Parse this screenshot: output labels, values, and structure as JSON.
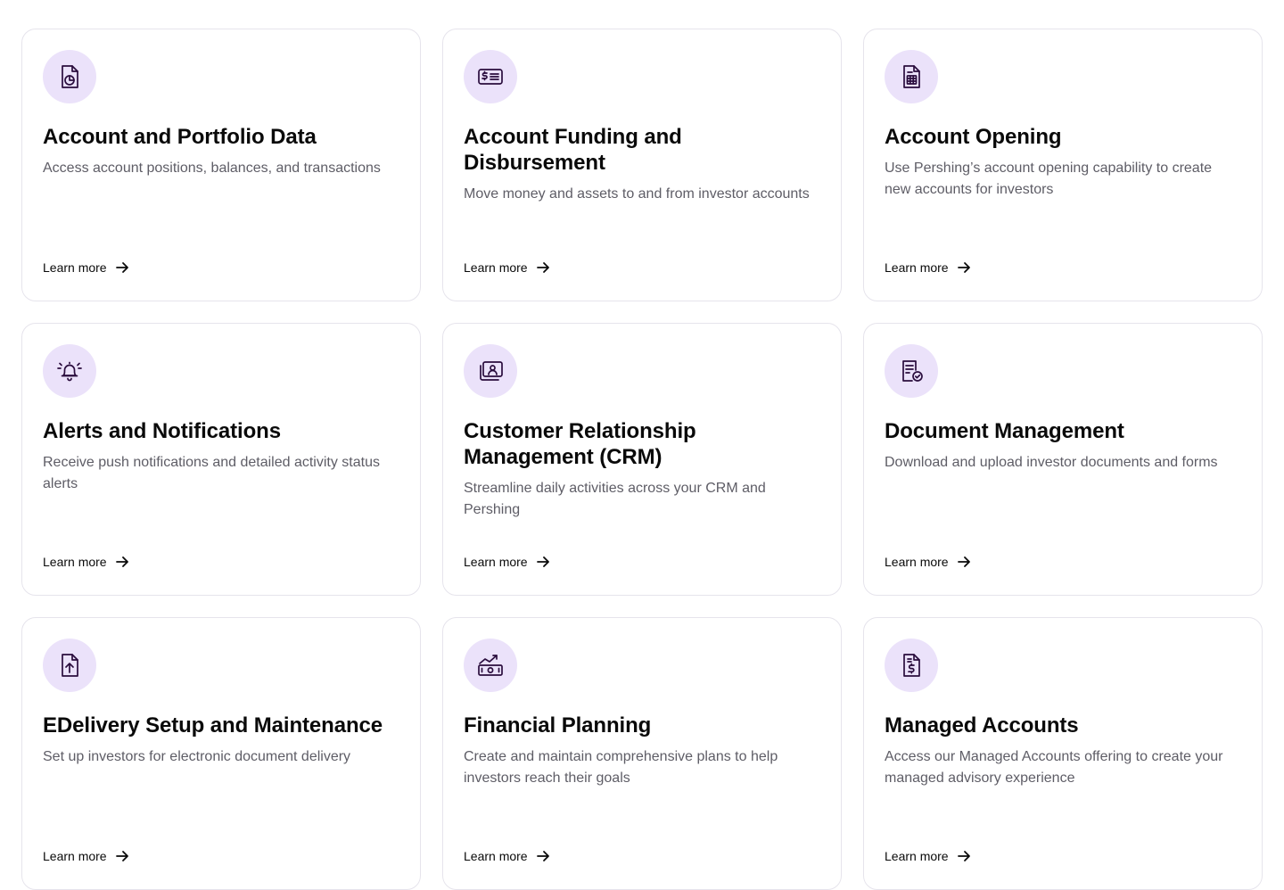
{
  "colors": {
    "icon_bg": "#ebe2fa",
    "icon_stroke": "#2a0d3d",
    "card_border": "#e6e4ec",
    "description": "#5e5d66"
  },
  "cards": [
    {
      "icon": "document-chart-icon",
      "title": "Account and Portfolio Data",
      "description": "Access account positions, balances, and transactions",
      "link": "Learn more"
    },
    {
      "icon": "dollar-card-icon",
      "title": "Account Funding and Disbursement",
      "description": "Move money and assets to and from investor accounts",
      "link": "Learn more"
    },
    {
      "icon": "document-calculator-icon",
      "title": "Account Opening",
      "description": "Use Pershing’s account opening capability to create new accounts for investors",
      "link": "Learn more"
    },
    {
      "icon": "bell-icon",
      "title": "Alerts and Notifications",
      "description": "Receive push notifications and detailed activity status alerts",
      "link": "Learn more"
    },
    {
      "icon": "contact-card-icon",
      "title": "Customer Relationship Management (CRM)",
      "description": "Streamline daily activities across your CRM and Pershing",
      "link": "Learn more"
    },
    {
      "icon": "document-check-icon",
      "title": "Document Management",
      "description": "Download and upload investor documents and forms",
      "link": "Learn more"
    },
    {
      "icon": "document-upload-icon",
      "title": "EDelivery Setup and Maintenance",
      "description": "Set up investors for electronic document delivery",
      "link": "Learn more"
    },
    {
      "icon": "money-growth-icon",
      "title": "Financial Planning",
      "description": "Create and maintain comprehensive plans to help investors reach their goals",
      "link": "Learn more"
    },
    {
      "icon": "document-dollar-icon",
      "title": "Managed Accounts",
      "description": "Access our Managed Accounts offering to create your managed advisory experience",
      "link": "Learn more"
    }
  ]
}
